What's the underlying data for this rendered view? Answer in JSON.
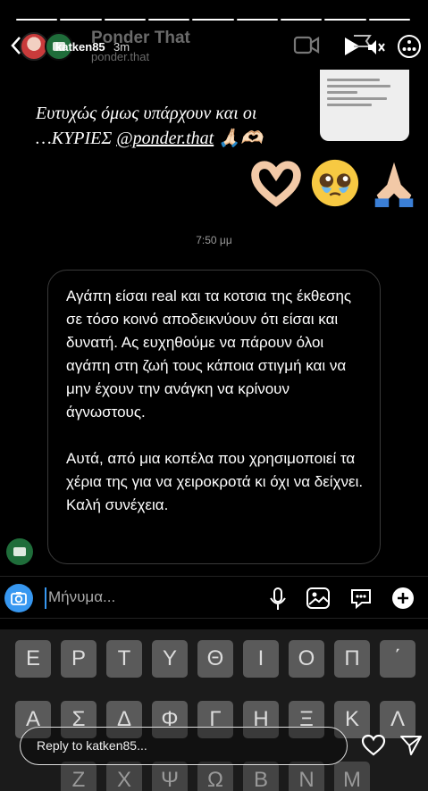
{
  "story": {
    "progress_segments": 9,
    "user": "katken85",
    "time": "3m"
  },
  "chat_header": {
    "title": "Ponder That",
    "handle": "ponder.that"
  },
  "note": {
    "line1": "Ευτυχώς όμως υπάρχουν και οι",
    "line2_prefix": "…ΚΥΡΙΕΣ ",
    "link": "@ponder.that",
    "emojis": [
      "heart-hands",
      "pleading-face",
      "folded-hands"
    ]
  },
  "thread": {
    "timestamp": "7:50 μμ",
    "message_paragraph_1": "Αγάπη είσαι real και τα κοτσια της έκθεσης σε τόσο κοινό αποδεικνύουν ότι είσαι και δυνατή. Ας ευχηθούμε να πάρουν όλοι αγάπη στη ζωή τους κάποια στιγμή και να μην έχουν την ανάγκη να κρίνουν άγνωστους.",
    "message_paragraph_2": "Αυτά, από μια κοπέλα που χρησιμοποιεί τα χέρια της για να χειροκροτά κι όχι να δείχνει. Καλή συνέχεια."
  },
  "composer": {
    "placeholder": "Μήνυμα...",
    "icons": [
      "camera-icon",
      "microphone-icon",
      "gallery-icon",
      "sticker-icon",
      "plus-icon"
    ]
  },
  "keyboard": {
    "row1": [
      "Ε",
      "Ρ",
      "Τ",
      "Υ",
      "Θ",
      "Ι",
      "Ο",
      "Π",
      "΄"
    ],
    "row2": [
      "Α",
      "Σ",
      "Δ",
      "Φ",
      "Γ",
      "Η",
      "Ξ",
      "Κ",
      "Λ"
    ],
    "row3": [
      "Ζ",
      "Χ",
      "Ψ",
      "Ω",
      "Β",
      "Ν",
      "Μ"
    ]
  },
  "reply": {
    "placeholder": "Reply to katken85..."
  },
  "colors": {
    "accent": "#3797f0",
    "header_text": "#6a6a6a",
    "bubble_border": "#3a3a3a",
    "key_bg": "#5a5a5a"
  }
}
